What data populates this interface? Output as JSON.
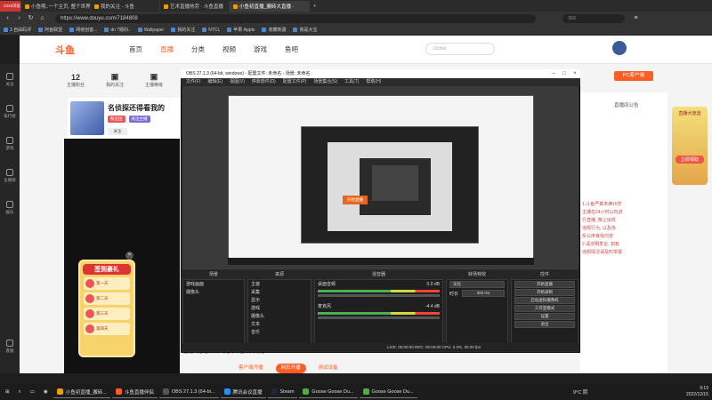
{
  "browser": {
    "brand": "2345浏览器",
    "tabs": [
      {
        "label": "小鱼哦..一个主页, 整个世界 ·",
        "active": false
      },
      {
        "label": "我的关注 - 斗鱼",
        "active": false
      },
      {
        "label": "艺术直播热劳 · 斗鱼直播",
        "active": false
      },
      {
        "label": "小鱼初直播_搬砖大直播 ·",
        "active": true
      }
    ],
    "url": "https://www.douyu.com/7184808",
    "search_placeholder": "360",
    "bookmarks": [
      "3 自由码评",
      "阿鱼联盟",
      "网络创客...",
      "dn ?题科..",
      "Wallpaper",
      "我的关注",
      "NTCL",
      "苹果 Apple",
      "收藏新疆",
      "我是大宝"
    ]
  },
  "rail": [
    "关注",
    "排行榜",
    "游戏",
    "主播榜",
    "娱乐",
    "",
    "客服"
  ],
  "site": {
    "logo": "斗鱼",
    "nav": [
      {
        "label": "首页",
        "active": false
      },
      {
        "label": "直播",
        "active": true
      },
      {
        "label": "分类",
        "active": false
      },
      {
        "label": "视频",
        "active": false
      },
      {
        "label": "游戏",
        "active": false
      },
      {
        "label": "鱼吧",
        "active": false
      }
    ],
    "search_placeholder": "Ocitet",
    "pc_client": "PC客户端",
    "stats": [
      {
        "value": "12",
        "label": "主播粉丝"
      },
      {
        "value": "",
        "label": "我的关注"
      },
      {
        "value": "",
        "label": "主播等级"
      }
    ]
  },
  "anchor": {
    "name": "名侦探还得看我的",
    "badge_red": "粉丝团",
    "badge_blue": "关注主播",
    "follow_label": "关注"
  },
  "gift": {
    "title": "签到豪礼",
    "days": [
      "第一天",
      "第二天",
      "第三天",
      "第四天"
    ]
  },
  "right_panel": {
    "title": "直播间公告",
    "promo_title": "直播大放送",
    "promo_cta": "立即领取",
    "rules": [
      "1.斗鱼严禁未满18岁",
      "主播在24小时以内进",
      "行直播, 禁止出现",
      "违规行为, 以及违",
      "反公序良俗内容",
      "2.请文明发言, 如有",
      "违规情况请及时举报"
    ]
  },
  "bottom": {
    "notice": "直播间管理须知, 请遵守斗鱼相关规定",
    "btn_client": "客户端开播",
    "btn_web": "网页开播",
    "btn_test": "测试设备"
  },
  "obs": {
    "title": "OBS 27.1.3 (64-bit, windows) - 配置文件: 未命名 - 场景: 未命名",
    "menu": [
      "文件(F)",
      "编辑(E)",
      "视图(V)",
      "停靠部件(D)",
      "配置文件(P)",
      "场景集合(S)",
      "工具(T)",
      "帮助(H)"
    ],
    "nested_button": "开始直播",
    "dock_headers": [
      "场景",
      "来源",
      "混音器",
      "转场特效",
      "控件"
    ],
    "scenes": [
      "游戏画面",
      "摄像头"
    ],
    "sources": [
      "主窗",
      "采集",
      "显示",
      "游戏",
      "摄像头",
      "文本",
      "音乐"
    ],
    "mixer": [
      {
        "name": "桌面音频",
        "db": "0.0 dB"
      },
      {
        "name": "麦克风",
        "db": "-4.4 dB"
      }
    ],
    "transition": {
      "type": "淡化",
      "duration_label": "时长",
      "duration": "300 ms"
    },
    "controls": [
      "开始直播",
      "开始录制",
      "启动虚拟摄像机",
      "工作室模式",
      "设置",
      "退出"
    ],
    "status": "LIVE: 00:00:00   REC: 00:00:00   CPU: 2.3%, 30.00 fps"
  },
  "taskbar": {
    "items": [
      {
        "label": "小鱼初直播_搬砖...",
        "color": "#e8a000"
      },
      {
        "label": "斗鱼直播伴侣",
        "color": "#ff5d23"
      },
      {
        "label": "OBS 27.1.3 (64-bi...",
        "color": "#333333"
      },
      {
        "label": "腾讯会议直播",
        "color": "#2a8cff"
      },
      {
        "label": "Steam",
        "color": "#1b2838"
      },
      {
        "label": "Goose Goose Du...",
        "color": "#5a4"
      },
      {
        "label": "Goose Goose Du...",
        "color": "#5a4"
      }
    ],
    "weather": "9°C 阴",
    "time": "9:19",
    "date": "2022/12/15"
  },
  "colors": {
    "accent": "#ff5d23"
  }
}
